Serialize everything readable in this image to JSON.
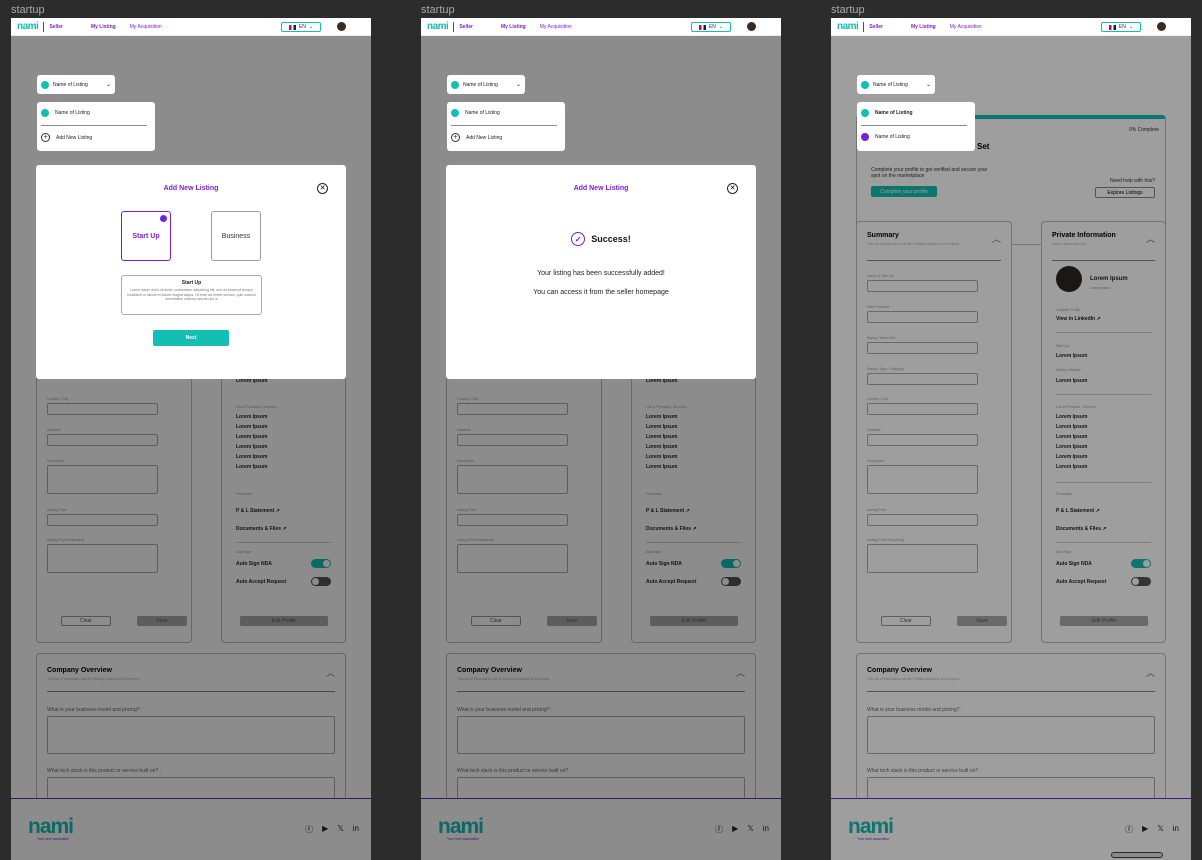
{
  "frames": [
    {
      "label": "startup"
    },
    {
      "label": "startup"
    },
    {
      "label": "startup"
    }
  ],
  "nav": {
    "logo": "nami",
    "seller": "Seller",
    "my_listing": "My Listing",
    "my_acquisition": "My Acquisition",
    "lang": "EN"
  },
  "dropdown": {
    "selected": "Name of Listing",
    "items": [
      "Name of Listing",
      "Add New Listing"
    ],
    "item_listing2": "Name of Listing"
  },
  "progress": {
    "percent": "0% Complete",
    "title_suffix": "Set",
    "text": "Complete your profile to get verified and secure your spot on the marketplace",
    "complete_btn": "Complete your profile",
    "help": "Need help with this?",
    "explore_btn": "Explore Listings"
  },
  "summary": {
    "title": "Summary",
    "subtitle": "This list of information will be Publicly Available to Everyone",
    "fields": [
      "Name of Start-Up",
      "Date Founded",
      "Startup Team Size",
      "Startup Type / Category",
      "Country / City",
      "Headline",
      "Description",
      "Asking Price",
      "Asking Price Reasoning"
    ],
    "clear": "Clear",
    "save": "Save"
  },
  "private": {
    "title": "Private Information",
    "subtitle": "Lorem Ipsum dolor sit",
    "name": "Lorem Ipsum",
    "role": "Lorem ipsum",
    "linkedin_label": "LinkedIn Profile",
    "linkedin": "View in LinkedIn",
    "startup_label": "Start Up",
    "startup_value": "Lorem Ipsum",
    "website_label": "Startup Website",
    "website_value": "Lorem Ipsum",
    "products_label": "List of Products / Services",
    "products": [
      "Lorem Ipsum",
      "Lorem Ipsum",
      "Lorem Ipsum",
      "Lorem Ipsum",
      "Lorem Ipsum",
      "Lorem Ipsum"
    ],
    "financials_label": "Financials",
    "pl": "P & L Statement",
    "docs": "Documents & Files",
    "autosign_label": "Auto Sign",
    "nda": "Auto Sign NDA",
    "accept": "Auto Accept Request",
    "edit": "Edit Profile"
  },
  "company": {
    "title": "Company Overview",
    "subtitle": "This list of information will be Publicly Available to Everyone",
    "q1": "What is your business model and pricing? :",
    "q2": "What tech stack is this product or service built on? :"
  },
  "footer": {
    "logo": "nami",
    "tagline": "Your next acquisition"
  },
  "modal_add": {
    "title": "Add New Listing",
    "opt1": "Start Up",
    "opt2": "Business",
    "desc_title": "Start Up",
    "desc_text": "Lorem ipsum dolor sit amet, consectetur adipiscing elit, sed do eiusmod tempor incididunt ut labore et dolore magna aliqua. Ut enim ad minim veniam, quis nostrud exercitation ullamco laboris nisi ut",
    "next": "Next"
  },
  "modal_success": {
    "title": "Add New Listing",
    "head": "Success!",
    "line1": "Your listing has been successfully added!",
    "line2": "You can access it from the seller homepage"
  },
  "colors": {
    "brand_purple": "#7a1fd6",
    "brand_teal": "#13bfb2"
  }
}
